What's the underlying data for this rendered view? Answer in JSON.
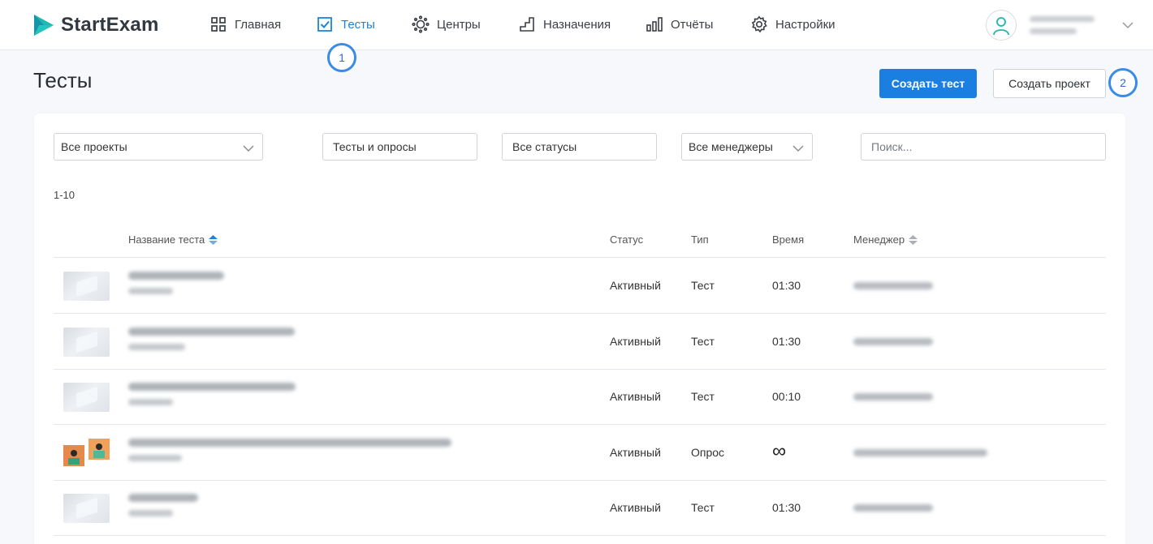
{
  "app": {
    "name": "StartExam"
  },
  "nav": {
    "items": [
      {
        "label": "Главная",
        "icon": "grid-icon",
        "active": false
      },
      {
        "label": "Тесты",
        "icon": "checkbox-icon",
        "active": true
      },
      {
        "label": "Центры",
        "icon": "sun-icon",
        "active": false
      },
      {
        "label": "Назначения",
        "icon": "stairs-icon",
        "active": false
      },
      {
        "label": "Отчёты",
        "icon": "bar-chart-icon",
        "active": false
      },
      {
        "label": "Настройки",
        "icon": "gear-icon",
        "active": false
      }
    ]
  },
  "callouts": {
    "first": "1",
    "second": "2"
  },
  "page": {
    "title": "Тесты",
    "create_test": "Создать тест",
    "create_project": "Создать проект"
  },
  "filters": {
    "projects": "Все проекты",
    "types": "Тесты и опросы",
    "statuses": "Все статусы",
    "managers": "Все менеджеры",
    "search_placeholder": "Поиск..."
  },
  "range": "1-10",
  "table": {
    "headers": {
      "name": "Название теста",
      "status": "Статус",
      "type": "Тип",
      "time": "Время",
      "manager": "Менеджер"
    },
    "rows": [
      {
        "status": "Активный",
        "type": "Тест",
        "time": "01:30"
      },
      {
        "status": "Активный",
        "type": "Тест",
        "time": "01:30"
      },
      {
        "status": "Активный",
        "type": "Тест",
        "time": "00:10"
      },
      {
        "status": "Активный",
        "type": "Опрос",
        "time": "∞"
      },
      {
        "status": "Активный",
        "type": "Тест",
        "time": "01:30"
      }
    ]
  },
  "colors": {
    "accent": "#1a7fe0",
    "logo": "#1fb5b0",
    "callout": "#3a8be8"
  }
}
